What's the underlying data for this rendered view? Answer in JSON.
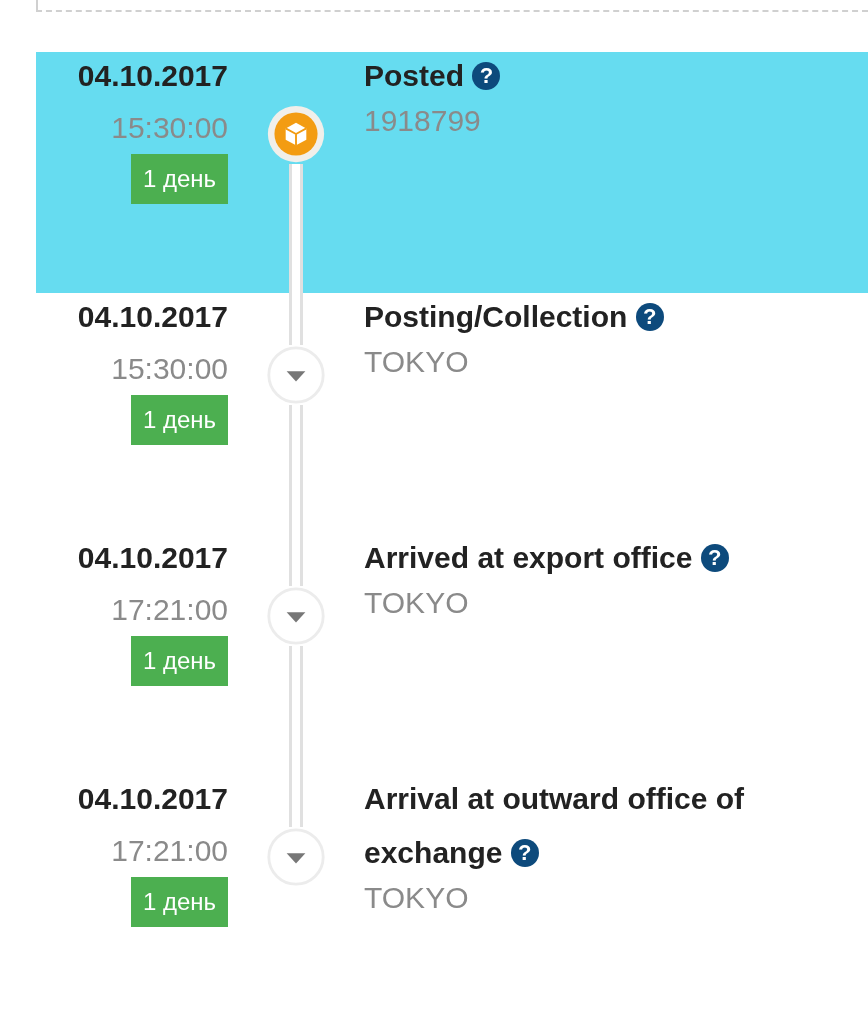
{
  "events": [
    {
      "date": "04.10.2017",
      "time": "15:30:00",
      "badge": "1 день",
      "title": "Posted",
      "help": "?",
      "detail": "1918799",
      "kind": "box",
      "selected": true
    },
    {
      "date": "04.10.2017",
      "time": "15:30:00",
      "badge": "1 день",
      "title": "Posting/Collection",
      "help": "?",
      "detail": "TOKYO",
      "kind": "arrow",
      "selected": false
    },
    {
      "date": "04.10.2017",
      "time": "17:21:00",
      "badge": "1 день",
      "title": "Arrived at export office",
      "help": "?",
      "detail": "TOKYO",
      "kind": "arrow",
      "selected": false
    },
    {
      "date": "04.10.2017",
      "time": "17:21:00",
      "badge": "1 день",
      "title": "Arrival at outward office of exchange",
      "help": "?",
      "detail": "TOKYO",
      "kind": "arrow",
      "selected": false
    }
  ]
}
